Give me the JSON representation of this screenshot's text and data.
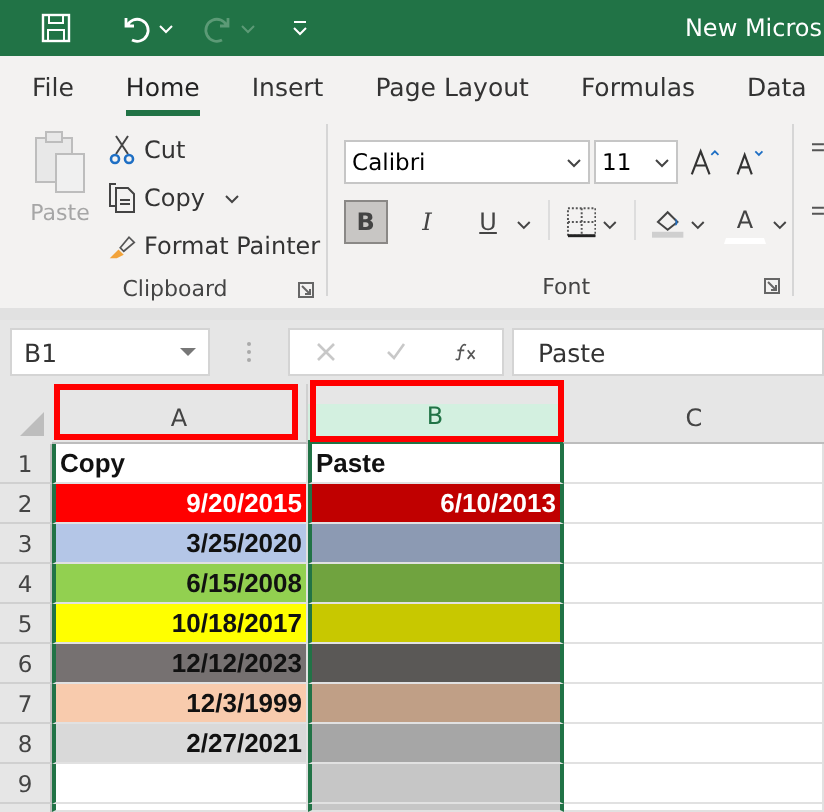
{
  "title_bar": {
    "title": "New Micros"
  },
  "tabs": [
    {
      "label": "File",
      "selected": false
    },
    {
      "label": "Home",
      "selected": true
    },
    {
      "label": "Insert",
      "selected": false
    },
    {
      "label": "Page Layout",
      "selected": false
    },
    {
      "label": "Formulas",
      "selected": false
    },
    {
      "label": "Data",
      "selected": false
    }
  ],
  "clipboard": {
    "paste": {
      "label": "Paste",
      "disabled": true
    },
    "items": [
      {
        "kind": "cut",
        "label": "Cut"
      },
      {
        "kind": "copy",
        "label": "Copy"
      },
      {
        "kind": "painter",
        "label": "Format Painter"
      }
    ],
    "group_label": "Clipboard"
  },
  "font": {
    "family": "Calibri",
    "size": "11",
    "bold": {
      "label": "B",
      "selected": true
    },
    "italic": {
      "label": "I",
      "selected": false
    },
    "underline": {
      "label": "U",
      "selected": false
    },
    "font_color": {
      "label": "A"
    },
    "group_label": "Font"
  },
  "formula_bar": {
    "name_box": "B1",
    "formula": "Paste"
  },
  "columns": [
    {
      "label": "A",
      "selected": false,
      "highlighted": true,
      "copy_marquee": true
    },
    {
      "label": "B",
      "selected": true,
      "highlighted": true,
      "copy_marquee": false
    },
    {
      "label": "C",
      "selected": false,
      "highlighted": false,
      "copy_marquee": false
    }
  ],
  "rows": [
    {
      "number": "1",
      "cells": [
        {
          "kind": "text",
          "value": "Copy"
        },
        {
          "kind": "text",
          "value": "Paste"
        }
      ]
    },
    {
      "number": "2",
      "cells": [
        {
          "kind": "date",
          "value": "9/20/2015",
          "color": "#ff0000"
        },
        {
          "kind": "date",
          "value": "6/10/2013",
          "color": "#c00000"
        }
      ]
    },
    {
      "number": "3",
      "cells": [
        {
          "kind": "date",
          "value": "3/25/2020",
          "color": "#b4c6e7"
        },
        {
          "color": "#8c9ab3"
        }
      ]
    },
    {
      "number": "4",
      "cells": [
        {
          "kind": "date",
          "value": "6/15/2008",
          "color": "#92d050"
        },
        {
          "color": "#70a33f"
        }
      ]
    },
    {
      "number": "5",
      "cells": [
        {
          "kind": "date",
          "value": "10/18/2017",
          "color": "#ffff00"
        },
        {
          "color": "#c8c800"
        }
      ]
    },
    {
      "number": "6",
      "cells": [
        {
          "kind": "date",
          "value": "12/12/2023",
          "color": "#767171"
        },
        {
          "color": "#5a5856"
        }
      ]
    },
    {
      "number": "7",
      "cells": [
        {
          "kind": "date",
          "value": "12/3/1999",
          "color": "#f8cbad"
        },
        {
          "color": "#c09f86"
        }
      ]
    },
    {
      "number": "8",
      "cells": [
        {
          "kind": "date",
          "value": "2/27/2021",
          "color": "#d9d9d9"
        },
        {
          "color": "#a6a6a6"
        }
      ]
    },
    {
      "number": "9",
      "cells": [
        {},
        {
          "color": "#c6c6c6"
        }
      ]
    }
  ]
}
